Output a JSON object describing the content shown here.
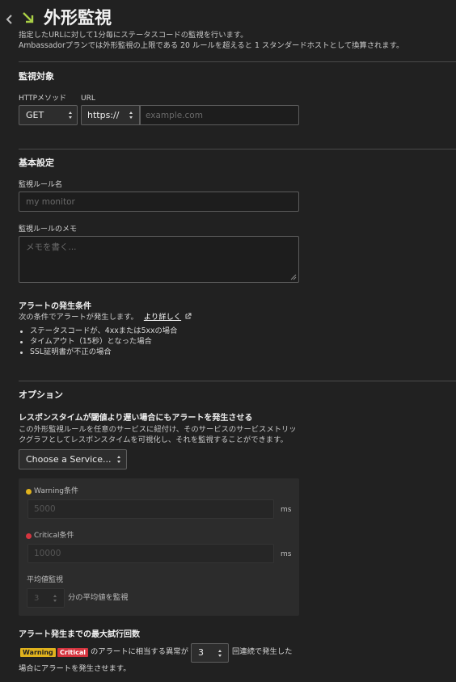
{
  "header": {
    "title": "外形監視",
    "desc_line1": "指定したURLに対して1分毎にステータスコードの監視を行います。",
    "desc_line2": "Ambassadorプランでは外形監視の上限である 20 ルールを超えると 1 スタンダードホストとして換算されます。"
  },
  "target": {
    "heading": "監視対象",
    "method_label": "HTTPメソッド",
    "method_value": "GET",
    "url_label": "URL",
    "scheme_value": "https://",
    "url_placeholder": "example.com"
  },
  "basic": {
    "heading": "基本設定",
    "name_label": "監視ルール名",
    "name_placeholder": "my monitor",
    "memo_label": "監視ルールのメモ",
    "memo_placeholder": "メモを書く..."
  },
  "alert_conditions": {
    "heading": "アラートの発生条件",
    "intro": "次の条件でアラートが発生します。",
    "learn_more": "より詳しく",
    "items": [
      "ステータスコードが、4xxまたは5xxの場合",
      "タイムアウト（15秒）となった場合",
      "SSL証明書が不正の場合"
    ]
  },
  "options": {
    "heading": "オプション",
    "response_heading": "レスポンスタイムが閾値より遅い場合にもアラートを発生させる",
    "response_desc_line1": "この外形監視ルールを任意のサービスに紐付け、そのサービスのサービスメトリッ",
    "response_desc_line2": "クグラフとしてレスポンスタイムを可視化し、それを監視することができます。",
    "service_select": "Choose a Service...",
    "warning_label": "Warning条件",
    "warning_placeholder": "5000",
    "critical_label": "Critical条件",
    "critical_placeholder": "10000",
    "unit_ms": "ms",
    "average_label": "平均値監視",
    "average_value": "3",
    "average_suffix": "分の平均値を監視"
  },
  "retry": {
    "heading": "アラート発生までの最大試行回数",
    "badge_warning": "Warning",
    "badge_critical": "Critical",
    "text_before": "のアラートに相当する異常が",
    "count": "3",
    "text_after": "回連続で発生した",
    "text_line2": "場合にアラートを発生させます。"
  },
  "colors": {
    "warning": "#e0b21d",
    "critical": "#d5353f",
    "accent": "#a9cf46"
  }
}
